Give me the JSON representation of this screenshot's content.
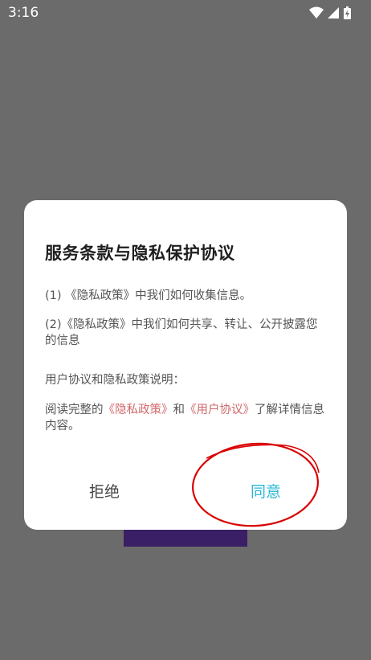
{
  "status_bar": {
    "time": "3:16",
    "icons": [
      "wifi-icon",
      "signal-icon",
      "battery-icon"
    ]
  },
  "dialog": {
    "title": "服务条款与隐私保护协议",
    "paragraph1": "(1) 《隐私政策》中我们如何收集信息。",
    "paragraph2": "(2)《隐私政策》中我们如何共享、转让、公开披露您的信息",
    "paragraph3": "用户协议和隐私政策说明：",
    "paragraph4": {
      "prefix": "阅读完整的",
      "privacy_link": "《隐私政策》",
      "connector": "和",
      "user_link": "《用户协议》",
      "suffix": "了解详情信息内容。"
    },
    "decline_label": "拒绝",
    "agree_label": "同意"
  },
  "colors": {
    "backdrop": "#6b6b6b",
    "link": "#d0686a",
    "agree": "#2bb7d5",
    "annotation": "#d90000"
  }
}
